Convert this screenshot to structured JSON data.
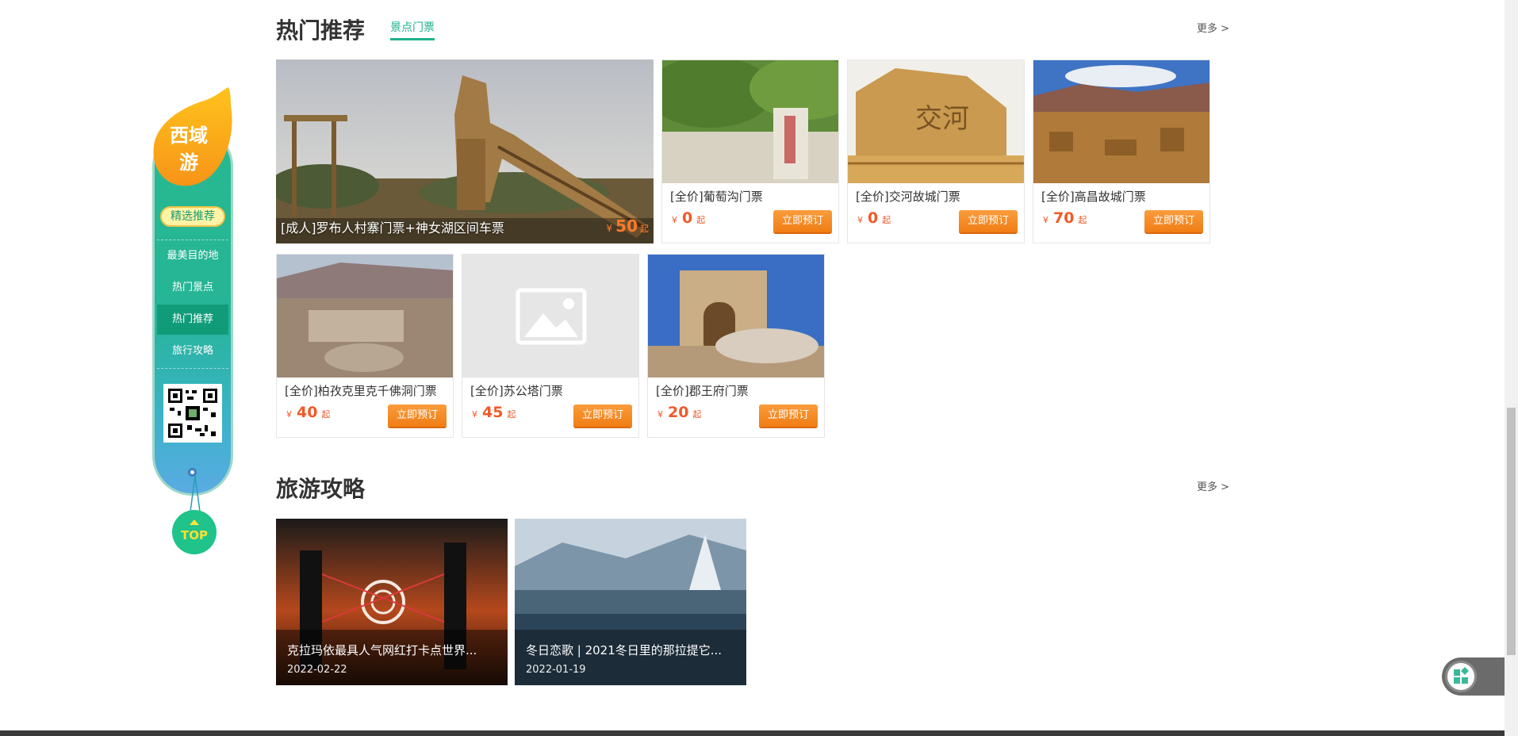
{
  "colors": {
    "accent": "#1eb28d",
    "price": "#f05a28",
    "book_button": "#f58a23",
    "nav_green": "#26b597"
  },
  "hot": {
    "title": "热门推荐",
    "tab": "景点门票",
    "more": "更多 >",
    "featured": {
      "name": "[成人]罗布人村寨门票+神女湖区间车票",
      "currency": "¥",
      "price": "50",
      "suffix": "起"
    },
    "tickets": [
      {
        "name": "[全价]葡萄沟门票",
        "currency": "¥",
        "price": "0",
        "suffix": "起",
        "button": "立即预订"
      },
      {
        "name": "[全价]交河故城门票",
        "currency": "¥",
        "price": "0",
        "suffix": "起",
        "button": "立即预订"
      },
      {
        "name": "[全价]高昌故城门票",
        "currency": "¥",
        "price": "70",
        "suffix": "起",
        "button": "立即预订"
      },
      {
        "name": "[全价]柏孜克里克千佛洞门票",
        "currency": "¥",
        "price": "40",
        "suffix": "起",
        "button": "立即预订"
      },
      {
        "name": "[全价]苏公塔门票",
        "currency": "¥",
        "price": "45",
        "suffix": "起",
        "button": "立即预订"
      },
      {
        "name": "[全价]郡王府门票",
        "currency": "¥",
        "price": "20",
        "suffix": "起",
        "button": "立即预订"
      }
    ]
  },
  "guides": {
    "title": "旅游攻略",
    "more": "更多 >",
    "items": [
      {
        "title": "克拉玛依最具人气网红打卡点世界...",
        "date": "2022-02-22"
      },
      {
        "title": "冬日恋歌 | 2021冬日里的那拉提它...",
        "date": "2022-01-19"
      }
    ]
  },
  "sidenav": {
    "logo": "西域游",
    "badge": "精选推荐",
    "items": [
      "最美目的地",
      "热门景点",
      "热门推荐",
      "旅行攻略"
    ],
    "active": "热门推荐",
    "top_label": "TOP"
  }
}
